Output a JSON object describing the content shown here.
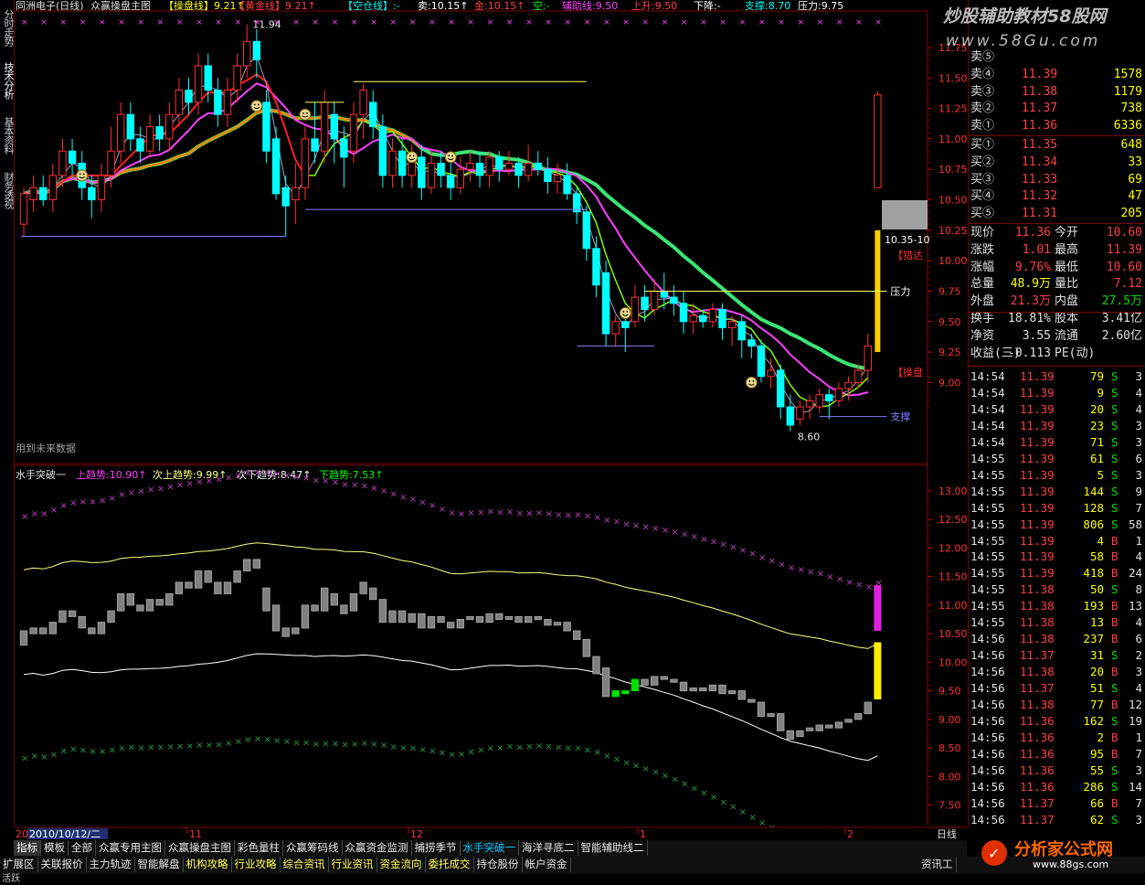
{
  "header": {
    "stock": "同洲电子(日线)",
    "indicator_name": "众赢操盘主图",
    "items": [
      {
        "label": "【操盘线】",
        "value": "9.21↑",
        "color": "#ffff00"
      },
      {
        "label": "【黄金线】",
        "value": "9.21↑",
        "color": "#ff4040"
      },
      {
        "label": "【空仓线】",
        "value": ":-",
        "color": "#00ffff"
      },
      {
        "label": "卖:",
        "value": "10.15↑",
        "color": "#ffffff"
      },
      {
        "label": "金:",
        "value": "10.15↑",
        "color": "#ff4040"
      },
      {
        "label": "空:",
        "value": "-",
        "color": "#00ff00"
      },
      {
        "label": "辅助线:",
        "value": "9.50",
        "color": "#ff40ff"
      },
      {
        "label": "上升:",
        "value": "9.50",
        "color": "#ff4040"
      },
      {
        "label": "下降:",
        "value": "-",
        "color": "#ffffff"
      },
      {
        "label": "支撑:",
        "value": "8.70",
        "color": "#00ffff"
      },
      {
        "label": "压力:",
        "value": "9.75",
        "color": "#ffffff"
      }
    ]
  },
  "sidebar": {
    "tabs": [
      "分时走势",
      "技术分析",
      "基本资料",
      "财务透视"
    ]
  },
  "upper_axis": {
    "ticks": [
      "11.75",
      "11.50",
      "11.25",
      "11.00",
      "10.75",
      "10.50",
      "10.25",
      "10.00",
      "9.75",
      "9.50",
      "9.25",
      "9.00"
    ]
  },
  "lower_axis": {
    "ticks": [
      "13.00",
      "12.50",
      "12.00",
      "11.50",
      "11.00",
      "10.50",
      "10.00",
      "9.50",
      "9.00",
      "8.50",
      "8.00",
      "7.50"
    ]
  },
  "annotations": {
    "high": "11.94",
    "low": "8.60",
    "pressure": "压力",
    "support": "支撑",
    "future": "用到未来数据",
    "right_time": "10.35-10",
    "sig1": "【猎达",
    "sig2": "【操盘"
  },
  "lower": {
    "title": "水手突破一",
    "items": [
      {
        "label": "上趋势:",
        "value": "10.90↑",
        "color": "#ff40ff"
      },
      {
        "label": "次上趋势:",
        "value": "9.99↑",
        "color": "#ffff80"
      },
      {
        "label": "次下趋势:",
        "value": "8.47↑",
        "color": "#ffffff"
      },
      {
        "label": "下趋势:",
        "value": "7.53↑",
        "color": "#00ff00"
      }
    ]
  },
  "date_axis": {
    "start": "20",
    "selected": "2010/10/12/二",
    "months": [
      "11",
      "12",
      "1",
      "2"
    ],
    "period": "日线"
  },
  "tabs_row1": [
    "指标",
    "模板",
    "全部",
    "众赢专用主图",
    "众赢操盘主图",
    "彩色量柱",
    "众赢筹码线",
    "众赢资金监测",
    "捕捞季节",
    "水手突破一",
    "海洋寻底二",
    "智能辅助线二"
  ],
  "tabs_row2": [
    "扩展区",
    "关联报价",
    "主力轨迹",
    "智能解盘",
    "机构攻略",
    "行业攻略",
    "综合资讯",
    "行业资讯",
    "资金流向",
    "委托成交",
    "持仓股份",
    "帐户资金"
  ],
  "tabs_row2_right": "资讯工",
  "status_text": "活跃",
  "watermark_top": "炒股辅助教材58股网",
  "watermark_url": "www.58Gu.com",
  "watermark_bottom": "分析家公式网",
  "watermark_bottom_url": "www.88gs.com",
  "orderbook": {
    "asks": [
      {
        "label": "卖⑤",
        "price": "",
        "vol": ""
      },
      {
        "label": "卖④",
        "price": "11.39",
        "vol": "1578"
      },
      {
        "label": "卖③",
        "price": "11.38",
        "vol": "1179"
      },
      {
        "label": "卖②",
        "price": "11.37",
        "vol": "738"
      },
      {
        "label": "卖①",
        "price": "11.36",
        "vol": "6336"
      }
    ],
    "bids": [
      {
        "label": "买①",
        "price": "11.35",
        "vol": "648"
      },
      {
        "label": "买②",
        "price": "11.34",
        "vol": "33"
      },
      {
        "label": "买③",
        "price": "11.33",
        "vol": "69"
      },
      {
        "label": "买④",
        "price": "11.32",
        "vol": "47"
      },
      {
        "label": "买⑤",
        "price": "11.31",
        "vol": "205"
      }
    ]
  },
  "quote": [
    {
      "l1": "现价",
      "v1": "11.36",
      "c1": "#ff4040",
      "l2": "今开",
      "v2": "10.60",
      "c2": "#ff4040"
    },
    {
      "l1": "涨跌",
      "v1": "1.01",
      "c1": "#ff4040",
      "l2": "最高",
      "v2": "11.39",
      "c2": "#ff4040"
    },
    {
      "l1": "涨幅",
      "v1": "9.76%",
      "c1": "#ff4040",
      "l2": "最低",
      "v2": "10.60",
      "c2": "#ff4040"
    },
    {
      "l1": "总量",
      "v1": "48.9万",
      "c1": "#ffff00",
      "l2": "量比",
      "v2": "7.12",
      "c2": "#ff4040"
    },
    {
      "l1": "外盘",
      "v1": "21.3万",
      "c1": "#ff4040",
      "l2": "内盘",
      "v2": "27.5万",
      "c2": "#00e000"
    },
    {
      "l1": "换手",
      "v1": "18.81%",
      "c1": "#e0e0e0",
      "l2": "股本",
      "v2": "3.41亿",
      "c2": "#e0e0e0"
    },
    {
      "l1": "净资",
      "v1": "3.55",
      "c1": "#e0e0e0",
      "l2": "流通",
      "v2": "2.60亿",
      "c2": "#e0e0e0"
    },
    {
      "l1": "收益(三)",
      "v1": "-0.113",
      "c1": "#e0e0e0",
      "l2": "PE(动)",
      "v2": "",
      "c2": "#e0e0e0"
    }
  ],
  "ticks": [
    {
      "t": "14:54",
      "p": "11.39",
      "v": "79",
      "s": "S",
      "n": "3"
    },
    {
      "t": "14:54",
      "p": "11.39",
      "v": "9",
      "s": "S",
      "n": "4"
    },
    {
      "t": "14:54",
      "p": "11.39",
      "v": "20",
      "s": "S",
      "n": "4"
    },
    {
      "t": "14:54",
      "p": "11.39",
      "v": "23",
      "s": "S",
      "n": "3"
    },
    {
      "t": "14:54",
      "p": "11.39",
      "v": "71",
      "s": "S",
      "n": "3"
    },
    {
      "t": "14:55",
      "p": "11.39",
      "v": "61",
      "s": "S",
      "n": "6"
    },
    {
      "t": "14:55",
      "p": "11.39",
      "v": "5",
      "s": "S",
      "n": "3"
    },
    {
      "t": "14:55",
      "p": "11.39",
      "v": "144",
      "s": "S",
      "n": "9"
    },
    {
      "t": "14:55",
      "p": "11.39",
      "v": "128",
      "s": "S",
      "n": "7"
    },
    {
      "t": "14:55",
      "p": "11.39",
      "v": "806",
      "s": "S",
      "n": "58"
    },
    {
      "t": "14:55",
      "p": "11.39",
      "v": "4",
      "s": "B",
      "n": "1"
    },
    {
      "t": "14:55",
      "p": "11.39",
      "v": "58",
      "s": "B",
      "n": "4"
    },
    {
      "t": "14:55",
      "p": "11.39",
      "v": "418",
      "s": "B",
      "n": "24"
    },
    {
      "t": "14:55",
      "p": "11.38",
      "v": "50",
      "s": "S",
      "n": "8"
    },
    {
      "t": "14:55",
      "p": "11.38",
      "v": "193",
      "s": "B",
      "n": "13"
    },
    {
      "t": "14:55",
      "p": "11.38",
      "v": "13",
      "s": "B",
      "n": "4"
    },
    {
      "t": "14:56",
      "p": "11.38",
      "v": "237",
      "s": "B",
      "n": "6"
    },
    {
      "t": "14:56",
      "p": "11.37",
      "v": "31",
      "s": "S",
      "n": "2"
    },
    {
      "t": "14:56",
      "p": "11.38",
      "v": "20",
      "s": "B",
      "n": "3"
    },
    {
      "t": "14:56",
      "p": "11.37",
      "v": "51",
      "s": "S",
      "n": "4"
    },
    {
      "t": "14:56",
      "p": "11.38",
      "v": "77",
      "s": "B",
      "n": "12"
    },
    {
      "t": "14:56",
      "p": "11.36",
      "v": "162",
      "s": "S",
      "n": "19"
    },
    {
      "t": "14:56",
      "p": "11.36",
      "v": "2",
      "s": "B",
      "n": "1"
    },
    {
      "t": "14:56",
      "p": "11.36",
      "v": "95",
      "s": "B",
      "n": "7"
    },
    {
      "t": "14:56",
      "p": "11.36",
      "v": "55",
      "s": "S",
      "n": "3"
    },
    {
      "t": "14:56",
      "p": "11.36",
      "v": "286",
      "s": "S",
      "n": "14"
    },
    {
      "t": "14:56",
      "p": "11.37",
      "v": "66",
      "s": "B",
      "n": "7"
    },
    {
      "t": "14:56",
      "p": "11.37",
      "v": "62",
      "s": "S",
      "n": "3"
    }
  ],
  "chart_data": {
    "type": "candlestick",
    "upper_ylim": [
      8.6,
      11.94
    ],
    "lower_ylim": [
      7.5,
      13.2
    ],
    "candles": [
      [
        10.3,
        10.55,
        10.2,
        10.6
      ],
      [
        10.5,
        10.6,
        10.4,
        10.7
      ],
      [
        10.6,
        10.5,
        10.45,
        10.7
      ],
      [
        10.5,
        10.7,
        10.4,
        10.8
      ],
      [
        10.7,
        10.9,
        10.6,
        11.0
      ],
      [
        10.9,
        10.8,
        10.7,
        11.0
      ],
      [
        10.8,
        10.6,
        10.5,
        10.9
      ],
      [
        10.6,
        10.5,
        10.35,
        10.7
      ],
      [
        10.5,
        10.7,
        10.4,
        10.8
      ],
      [
        10.7,
        10.9,
        10.6,
        11.1
      ],
      [
        10.9,
        11.2,
        10.8,
        11.3
      ],
      [
        11.2,
        11.0,
        10.9,
        11.3
      ],
      [
        11.0,
        10.9,
        10.8,
        11.1
      ],
      [
        10.9,
        11.1,
        10.85,
        11.2
      ],
      [
        11.1,
        11.0,
        10.9,
        11.2
      ],
      [
        11.0,
        11.2,
        10.9,
        11.3
      ],
      [
        11.2,
        11.4,
        11.1,
        11.5
      ],
      [
        11.4,
        11.3,
        11.2,
        11.5
      ],
      [
        11.3,
        11.6,
        11.2,
        11.7
      ],
      [
        11.6,
        11.4,
        11.3,
        11.7
      ],
      [
        11.4,
        11.2,
        11.1,
        11.5
      ],
      [
        11.2,
        11.4,
        11.1,
        11.5
      ],
      [
        11.4,
        11.6,
        11.3,
        11.7
      ],
      [
        11.6,
        11.8,
        11.5,
        11.94
      ],
      [
        11.8,
        11.65,
        11.5,
        11.9
      ],
      [
        11.3,
        10.9,
        10.8,
        11.4
      ],
      [
        11.0,
        10.55,
        10.5,
        11.1
      ],
      [
        10.6,
        10.45,
        10.2,
        10.7
      ],
      [
        10.5,
        10.6,
        10.3,
        10.8
      ],
      [
        10.6,
        11.0,
        10.5,
        11.1
      ],
      [
        11.0,
        10.9,
        10.8,
        11.3
      ],
      [
        10.9,
        11.3,
        10.8,
        11.4
      ],
      [
        11.2,
        11.0,
        10.8,
        11.3
      ],
      [
        11.0,
        10.85,
        10.6,
        11.1
      ],
      [
        10.9,
        11.2,
        10.8,
        11.3
      ],
      [
        11.2,
        11.4,
        11.0,
        11.45
      ],
      [
        11.3,
        11.1,
        11.0,
        11.4
      ],
      [
        11.1,
        10.7,
        10.6,
        11.2
      ],
      [
        10.7,
        10.9,
        10.6,
        11.0
      ],
      [
        10.9,
        10.7,
        10.6,
        11.0
      ],
      [
        10.7,
        10.85,
        10.6,
        10.95
      ],
      [
        10.85,
        10.6,
        10.5,
        10.95
      ],
      [
        10.6,
        10.8,
        10.55,
        10.9
      ],
      [
        10.8,
        10.7,
        10.6,
        10.9
      ],
      [
        10.7,
        10.6,
        10.5,
        10.8
      ],
      [
        10.6,
        10.75,
        10.55,
        10.85
      ],
      [
        10.75,
        10.8,
        10.65,
        10.9
      ],
      [
        10.8,
        10.7,
        10.6,
        10.9
      ],
      [
        10.7,
        10.85,
        10.6,
        10.9
      ],
      [
        10.85,
        10.75,
        10.65,
        10.9
      ],
      [
        10.75,
        10.8,
        10.7,
        10.9
      ],
      [
        10.8,
        10.7,
        10.6,
        10.85
      ],
      [
        10.7,
        10.8,
        10.65,
        10.95
      ],
      [
        10.8,
        10.75,
        10.7,
        10.9
      ],
      [
        10.75,
        10.65,
        10.55,
        10.85
      ],
      [
        10.65,
        10.7,
        10.55,
        10.8
      ],
      [
        10.7,
        10.55,
        10.5,
        10.8
      ],
      [
        10.55,
        10.4,
        10.3,
        10.6
      ],
      [
        10.4,
        10.1,
        10.0,
        10.45
      ],
      [
        10.1,
        9.8,
        9.7,
        10.2
      ],
      [
        9.9,
        9.4,
        9.3,
        10.0
      ],
      [
        9.4,
        9.5,
        9.3,
        9.55
      ],
      [
        9.5,
        9.45,
        9.25,
        9.6
      ],
      [
        9.5,
        9.7,
        9.45,
        9.8
      ],
      [
        9.7,
        9.6,
        9.5,
        9.8
      ],
      [
        9.6,
        9.75,
        9.55,
        9.85
      ],
      [
        9.75,
        9.7,
        9.6,
        9.9
      ],
      [
        9.7,
        9.65,
        9.55,
        9.8
      ],
      [
        9.65,
        9.5,
        9.4,
        9.75
      ],
      [
        9.5,
        9.55,
        9.4,
        9.65
      ],
      [
        9.55,
        9.5,
        9.45,
        9.6
      ],
      [
        9.5,
        9.6,
        9.45,
        9.65
      ],
      [
        9.6,
        9.45,
        9.35,
        9.65
      ],
      [
        9.45,
        9.5,
        9.3,
        9.55
      ],
      [
        9.5,
        9.35,
        9.2,
        9.55
      ],
      [
        9.35,
        9.3,
        9.2,
        9.4
      ],
      [
        9.3,
        9.05,
        9.0,
        9.35
      ],
      [
        9.05,
        9.1,
        8.95,
        9.2
      ],
      [
        9.1,
        8.8,
        8.7,
        9.15
      ],
      [
        8.8,
        8.65,
        8.6,
        8.9
      ],
      [
        8.7,
        8.8,
        8.65,
        8.85
      ],
      [
        8.8,
        8.85,
        8.7,
        8.9
      ],
      [
        8.8,
        8.9,
        8.75,
        8.95
      ],
      [
        8.9,
        8.85,
        8.7,
        8.95
      ],
      [
        8.85,
        8.95,
        8.8,
        9.0
      ],
      [
        8.95,
        9.0,
        8.85,
        9.05
      ],
      [
        9.0,
        9.1,
        8.95,
        9.15
      ],
      [
        9.1,
        9.3,
        9.0,
        9.4
      ],
      [
        10.6,
        11.36,
        10.6,
        11.39
      ]
    ]
  }
}
